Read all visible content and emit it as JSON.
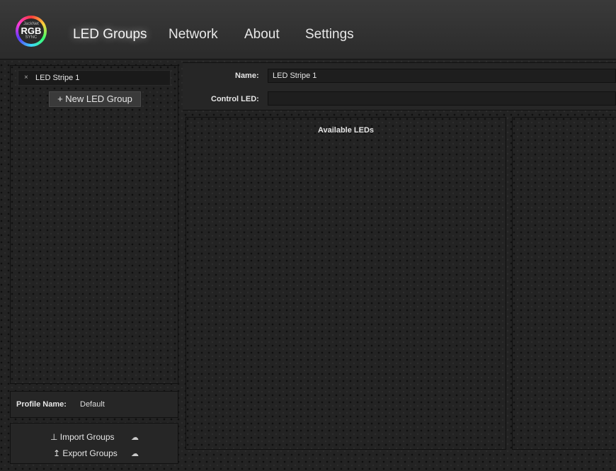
{
  "logo": {
    "line1": "JackNet",
    "line2": "RGB",
    "line3": "SYNC"
  },
  "nav": {
    "led_groups": "LED Groups",
    "network": "Network",
    "about": "About",
    "settings": "Settings"
  },
  "groups": {
    "items": [
      {
        "label": "LED Stripe 1",
        "remove_glyph": "×"
      }
    ],
    "new_button": "+ New LED Group"
  },
  "profile": {
    "label": "Profile Name:",
    "value": "Default"
  },
  "io": {
    "import_label": "Import Groups",
    "export_label": "Export Groups"
  },
  "editor": {
    "name_label": "Name:",
    "name_value": "LED Stripe 1",
    "control_label": "Control LED:",
    "control_value": ""
  },
  "available": {
    "title": "Available LEDs"
  },
  "icons": {
    "remove": "close-icon",
    "import": "download-icon",
    "export": "upload-icon",
    "cloud": "cloud-icon"
  }
}
